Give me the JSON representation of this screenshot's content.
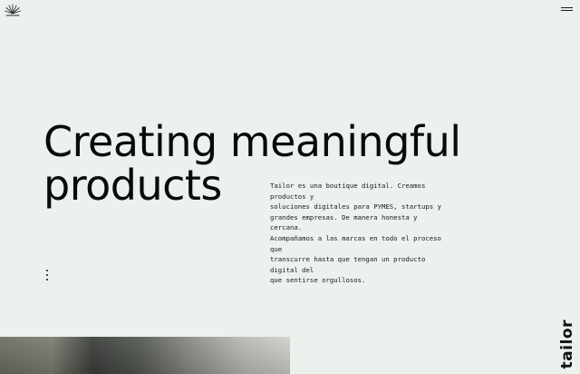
{
  "header": {
    "logo_icon": "tailor-sunburst-logo-icon",
    "menu_icon": "hamburger-menu-icon"
  },
  "hero": {
    "title_line1": "Creating meaningful",
    "title_line2": "products",
    "intro_lines": [
      "Tailor es una boutique digital. Creamos productos y",
      "soluciones digitales para PYMES, startups y",
      "grandes empresas. De manera honesta y cercana.",
      "Acompañamos a las marcas en todo el proceso que",
      "transcurre hasta que tengan un producto digital del",
      "que sentirse orgullosos."
    ],
    "more_icon": "vertical-dots-icon"
  },
  "brand": {
    "wordmark": "tailor"
  }
}
